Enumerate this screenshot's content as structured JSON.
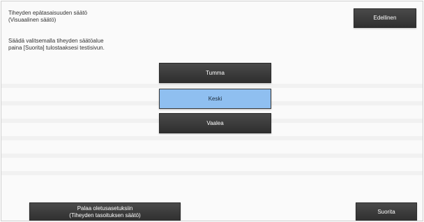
{
  "header": {
    "title_line1": "Tiheyden epätasaisuuden säätö",
    "title_line2": "(Visuaalinen säätö)",
    "back_label": "Edellinen"
  },
  "instructions": {
    "line1": "Säädä valitsemalla tiheyden säätöalue",
    "line2": "paina [Suorita] tulostaaksesi testisivun."
  },
  "options": {
    "dark": "Tumma",
    "medium": "Keski",
    "light": "Vaalea",
    "selected": "Keski"
  },
  "footer": {
    "reset_line1": "Palaa oletusasetuksiin",
    "reset_line2": "(Tiheyden tasoituksen säätö)",
    "run_label": "Suorita"
  },
  "colors": {
    "button_dark": "#3a3a3a",
    "button_selected": "#8fbff0",
    "background": "#fafafa"
  }
}
